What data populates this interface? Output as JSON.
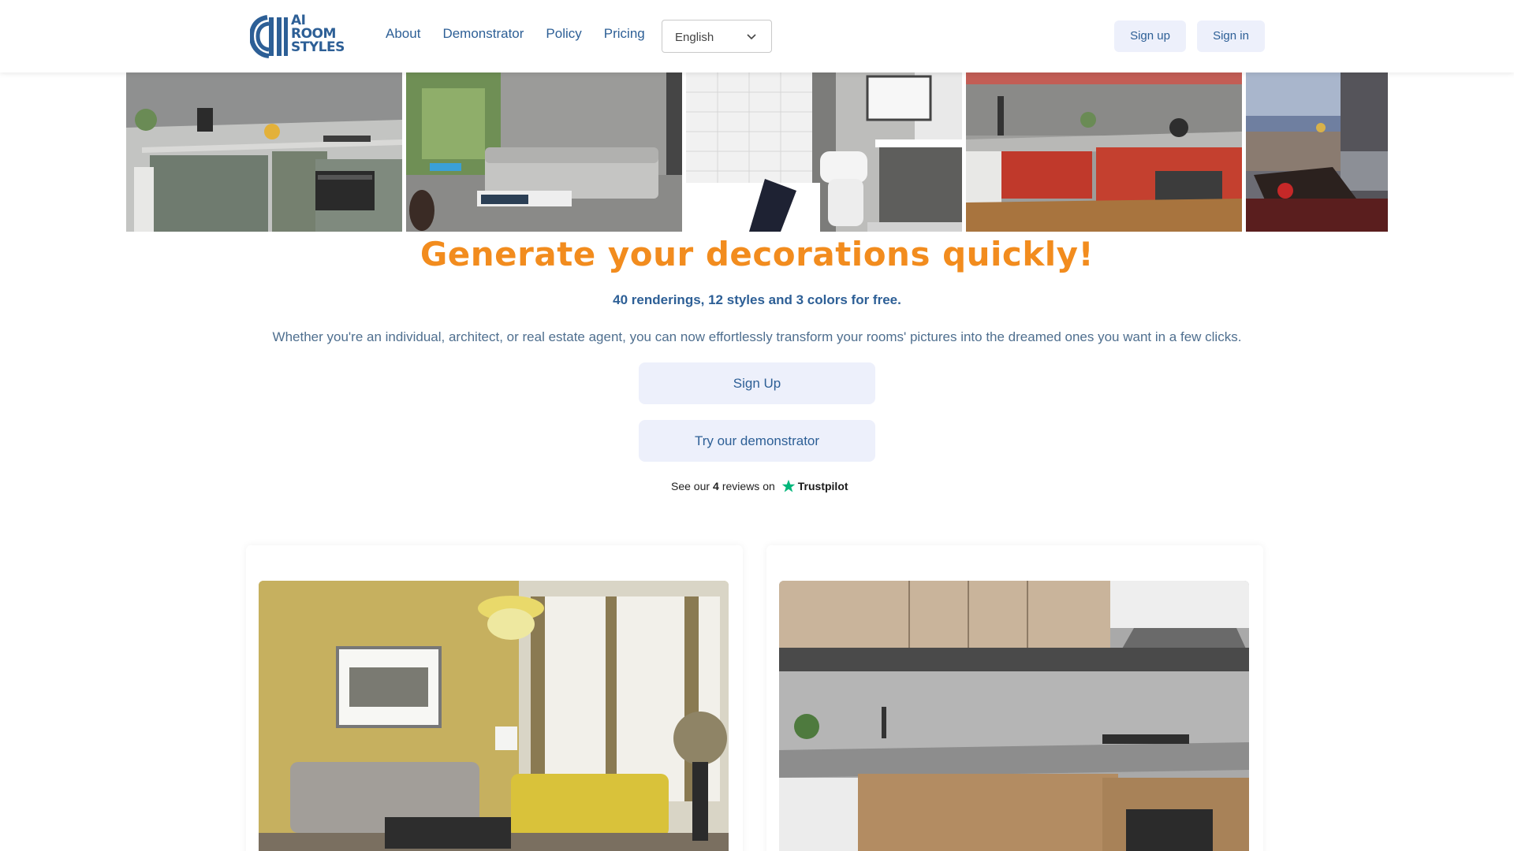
{
  "header": {
    "logo": {
      "line1": "AI",
      "line2": "ROOM",
      "line3": "STYLES"
    },
    "nav": [
      {
        "label": "About"
      },
      {
        "label": "Demonstrator"
      },
      {
        "label": "Policy"
      },
      {
        "label": "Pricing"
      }
    ],
    "language": {
      "selected": "English"
    },
    "signup_label": "Sign up",
    "signin_label": "Sign in"
  },
  "gallery": [
    {
      "name": "gray-kitchen"
    },
    {
      "name": "living-room"
    },
    {
      "name": "bathroom"
    },
    {
      "name": "red-kitchen"
    },
    {
      "name": "balcony-lounge"
    }
  ],
  "hero": {
    "title": "Generate your decorations quickly!",
    "subtitle": "40 renderings, 12 styles and 3 colors for free.",
    "description": "Whether you're an individual, architect, or real estate agent, you can now effortlessly transform your rooms' pictures into the dreamed ones you want in a few clicks.",
    "signup_cta": "Sign Up",
    "demo_cta": "Try our demonstrator"
  },
  "trustpilot": {
    "prefix": "See our",
    "count": "4",
    "suffix": "reviews on",
    "brand": "Trustpilot"
  },
  "colors": {
    "accent": "#f28c1e",
    "brand": "#2d5f96",
    "button_bg": "#edf0fb",
    "trustpilot_green": "#00b67a"
  }
}
